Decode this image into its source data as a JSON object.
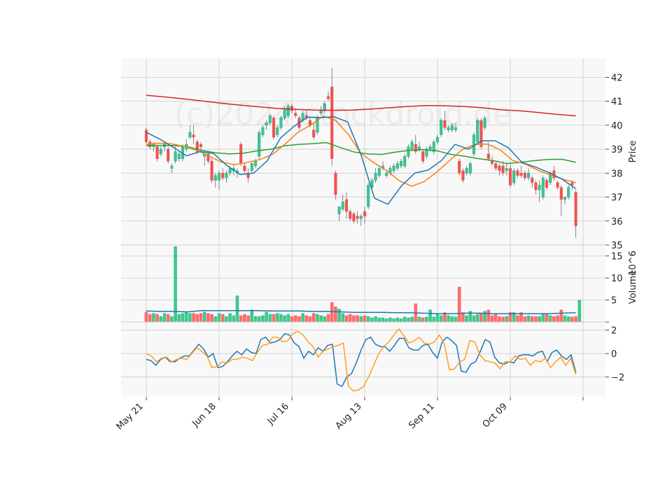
{
  "chart_data": {
    "type": "candlestick",
    "watermark": "(c)2024 stockdroid.de",
    "x_tick_labels": [
      "May 21",
      "Jun 18",
      "Jul 16",
      "Aug 13",
      "Sep 11",
      "Oct 09"
    ],
    "x_tick_index": [
      0,
      20,
      40,
      60,
      80,
      100
    ],
    "price_panel": {
      "ylabel": "Price",
      "ylim": [
        35,
        42.8
      ],
      "yticks": [
        35,
        36,
        37,
        38,
        39,
        40,
        41,
        42
      ],
      "candles": [
        [
          39.8,
          39.9,
          39.2,
          39.3
        ],
        [
          39.3,
          39.4,
          39.0,
          39.1
        ],
        [
          39.1,
          39.3,
          38.9,
          39.2
        ],
        [
          39.1,
          39.2,
          38.5,
          38.6
        ],
        [
          38.8,
          39.1,
          38.7,
          39.0
        ],
        [
          39.1,
          39.3,
          38.9,
          39.2
        ],
        [
          39.0,
          39.1,
          38.4,
          38.5
        ],
        [
          38.2,
          38.4,
          38.0,
          38.3
        ],
        [
          38.5,
          39.1,
          38.4,
          38.9
        ],
        [
          38.6,
          38.9,
          38.5,
          38.8
        ],
        [
          38.6,
          39.2,
          38.5,
          39.1
        ],
        [
          39.0,
          39.4,
          38.9,
          39.2
        ],
        [
          39.5,
          40.0,
          39.4,
          39.7
        ],
        [
          39.6,
          40.0,
          39.2,
          39.5
        ],
        [
          39.3,
          39.4,
          38.8,
          38.9
        ],
        [
          39.2,
          39.3,
          38.9,
          39.1
        ],
        [
          38.7,
          38.9,
          38.3,
          38.8
        ],
        [
          38.8,
          38.9,
          38.4,
          38.5
        ],
        [
          38.5,
          38.6,
          37.6,
          37.7
        ],
        [
          37.7,
          38.0,
          37.4,
          37.9
        ],
        [
          37.7,
          38.1,
          37.3,
          38.0
        ],
        [
          38.0,
          38.2,
          37.7,
          37.8
        ],
        [
          37.8,
          38.1,
          37.6,
          38.0
        ],
        [
          38.0,
          38.3,
          37.9,
          38.2
        ],
        [
          38.1,
          38.4,
          37.9,
          38.2
        ],
        [
          38.0,
          38.2,
          37.8,
          38.1
        ],
        [
          39.2,
          39.3,
          38.3,
          38.4
        ],
        [
          38.3,
          38.4,
          38.0,
          38.1
        ],
        [
          38.0,
          38.2,
          37.6,
          37.8
        ],
        [
          38.1,
          38.5,
          38.0,
          38.4
        ],
        [
          38.3,
          38.6,
          38.2,
          38.5
        ],
        [
          38.7,
          39.8,
          38.6,
          39.7
        ],
        [
          39.6,
          40.0,
          39.5,
          39.9
        ],
        [
          40.0,
          40.2,
          39.8,
          40.1
        ],
        [
          40.1,
          40.5,
          40.0,
          40.4
        ],
        [
          40.3,
          40.4,
          39.4,
          39.5
        ],
        [
          39.6,
          40.0,
          39.5,
          39.9
        ],
        [
          39.9,
          40.4,
          39.8,
          40.3
        ],
        [
          40.3,
          40.8,
          40.2,
          40.7
        ],
        [
          40.4,
          40.9,
          40.3,
          40.8
        ],
        [
          40.8,
          40.9,
          40.5,
          40.6
        ],
        [
          40.5,
          40.7,
          40.3,
          40.4
        ],
        [
          40.3,
          40.4,
          39.8,
          39.9
        ],
        [
          40.2,
          40.6,
          40.1,
          40.5
        ],
        [
          40.4,
          40.6,
          40.2,
          40.3
        ],
        [
          40.2,
          40.3,
          39.9,
          40.0
        ],
        [
          39.8,
          40.1,
          39.4,
          39.5
        ],
        [
          39.7,
          40.4,
          39.6,
          40.3
        ],
        [
          40.5,
          40.8,
          40.4,
          40.6
        ],
        [
          40.6,
          41.0,
          40.5,
          40.9
        ],
        [
          41.2,
          41.4,
          41.0,
          41.1
        ],
        [
          41.6,
          42.4,
          38.3,
          38.6
        ],
        [
          38.0,
          38.1,
          36.9,
          37.1
        ],
        [
          36.3,
          36.6,
          36.0,
          36.6
        ],
        [
          36.5,
          37.1,
          36.4,
          36.8
        ],
        [
          36.9,
          37.2,
          36.1,
          36.4
        ],
        [
          36.4,
          36.5,
          36.0,
          36.1
        ],
        [
          36.3,
          36.4,
          35.9,
          36.0
        ],
        [
          36.2,
          36.4,
          35.9,
          36.1
        ],
        [
          36.1,
          36.3,
          35.8,
          36.2
        ],
        [
          36.4,
          36.6,
          35.9,
          36.2
        ],
        [
          36.6,
          37.6,
          36.5,
          37.5
        ],
        [
          37.4,
          37.8,
          37.3,
          37.7
        ],
        [
          37.7,
          38.2,
          37.6,
          38.0
        ],
        [
          37.9,
          38.3,
          37.8,
          38.2
        ],
        [
          38.2,
          38.5,
          38.1,
          38.3
        ],
        [
          37.9,
          38.1,
          37.8,
          38.0
        ],
        [
          38.0,
          38.3,
          37.9,
          38.2
        ],
        [
          38.1,
          38.4,
          38.0,
          38.3
        ],
        [
          38.2,
          38.5,
          38.1,
          38.4
        ],
        [
          38.3,
          38.6,
          38.2,
          38.5
        ],
        [
          38.3,
          38.8,
          38.2,
          38.7
        ],
        [
          38.7,
          39.2,
          38.6,
          39.1
        ],
        [
          39.0,
          39.4,
          38.9,
          39.3
        ],
        [
          39.2,
          39.6,
          38.8,
          38.9
        ],
        [
          39.0,
          39.3,
          38.9,
          39.1
        ],
        [
          38.9,
          39.0,
          38.4,
          38.5
        ],
        [
          38.7,
          39.1,
          38.6,
          39.0
        ],
        [
          39.0,
          39.2,
          38.9,
          39.1
        ],
        [
          38.9,
          39.4,
          38.8,
          39.3
        ],
        [
          39.3,
          39.6,
          39.2,
          39.5
        ],
        [
          39.6,
          40.3,
          39.5,
          40.2
        ],
        [
          40.2,
          40.6,
          39.8,
          39.9
        ],
        [
          39.8,
          40.0,
          39.7,
          39.9
        ],
        [
          39.8,
          40.1,
          39.7,
          40.0
        ],
        [
          39.8,
          40.1,
          39.7,
          39.9
        ],
        [
          38.5,
          38.6,
          37.9,
          38.0
        ],
        [
          38.1,
          38.2,
          37.6,
          37.7
        ],
        [
          38.0,
          38.3,
          37.9,
          38.2
        ],
        [
          38.0,
          38.5,
          37.9,
          38.4
        ],
        [
          38.8,
          39.7,
          38.7,
          39.6
        ],
        [
          39.3,
          40.3,
          39.2,
          40.2
        ],
        [
          40.2,
          40.3,
          39.0,
          39.1
        ],
        [
          39.9,
          40.4,
          39.8,
          40.3
        ],
        [
          38.8,
          39.3,
          38.5,
          38.6
        ],
        [
          38.5,
          38.7,
          38.3,
          38.4
        ],
        [
          38.4,
          38.5,
          38.1,
          38.2
        ],
        [
          38.3,
          38.4,
          37.9,
          38.1
        ],
        [
          38.3,
          38.5,
          37.9,
          38.0
        ],
        [
          38.1,
          38.4,
          37.9,
          38.2
        ],
        [
          38.2,
          38.4,
          37.4,
          37.5
        ],
        [
          37.6,
          38.2,
          37.5,
          38.1
        ],
        [
          38.1,
          38.2,
          37.8,
          37.9
        ],
        [
          38.0,
          38.3,
          37.8,
          37.9
        ],
        [
          38.0,
          38.1,
          37.7,
          37.8
        ],
        [
          37.8,
          38.2,
          37.7,
          38.0
        ],
        [
          37.8,
          37.9,
          37.4,
          37.6
        ],
        [
          37.6,
          37.7,
          37.1,
          37.3
        ],
        [
          37.3,
          37.7,
          36.8,
          37.5
        ],
        [
          37.0,
          37.9,
          36.9,
          37.8
        ],
        [
          37.7,
          37.8,
          37.3,
          37.4
        ],
        [
          37.6,
          38.1,
          37.5,
          38.0
        ],
        [
          38.1,
          38.3,
          37.7,
          37.8
        ],
        [
          37.6,
          37.7,
          37.3,
          37.4
        ],
        [
          37.4,
          37.5,
          36.2,
          36.9
        ],
        [
          36.9,
          37.0,
          36.7,
          37.0
        ],
        [
          37.0,
          37.5,
          36.9,
          37.4
        ],
        [
          37.6,
          37.7,
          37.3,
          37.5
        ],
        [
          37.2,
          37.3,
          35.3,
          35.8
        ]
      ],
      "ma_series": [
        {
          "color": "#d62728",
          "values": [
            41.25,
            41.18,
            41.1,
            41.01,
            40.92,
            40.84,
            40.77,
            40.7,
            40.66,
            40.63,
            40.62,
            40.63,
            40.67,
            40.73,
            40.78,
            40.82,
            40.81,
            40.78,
            40.73,
            40.64,
            40.6,
            40.53,
            40.45,
            40.39
          ]
        },
        {
          "color": "#2ca02c",
          "values": [
            39.15,
            39.15,
            39.15,
            39.1,
            38.95,
            38.85,
            38.8,
            38.83,
            38.93,
            39.0,
            39.14,
            39.2,
            39.23,
            39.27,
            39.07,
            38.88,
            38.8,
            38.78,
            38.88,
            38.95,
            38.98,
            38.93,
            38.78,
            38.7,
            38.6,
            38.53,
            38.4,
            38.45,
            38.52,
            38.57,
            38.58,
            38.45
          ]
        },
        {
          "color": "#ff7f0e",
          "values": [
            39.2,
            39.25,
            39.22,
            39.12,
            38.95,
            38.7,
            38.45,
            38.35,
            38.44,
            38.57,
            38.78,
            39.22,
            39.7,
            40.0,
            40.38,
            40.2,
            39.6,
            38.82,
            38.44,
            38.12,
            37.69,
            37.45,
            37.65,
            38.05,
            38.52,
            38.98,
            39.2,
            39.21,
            38.98,
            38.53,
            38.38,
            38.12,
            37.92,
            37.74,
            37.6
          ]
        },
        {
          "color": "#1f77b4",
          "values": [
            39.7,
            39.42,
            39.08,
            38.72,
            38.9,
            38.82,
            38.32,
            37.94,
            38.0,
            38.51,
            39.47,
            39.95,
            40.33,
            40.32,
            40.35,
            40.14,
            38.76,
            36.95,
            36.7,
            37.46,
            38.0,
            38.13,
            38.53,
            39.2,
            39.0,
            39.35,
            39.35,
            39.05,
            38.44,
            38.25,
            38.02,
            37.74,
            37.35
          ]
        }
      ]
    },
    "volume_panel": {
      "ylabel": "Volume",
      "exponent": "10^6",
      "ylim": [
        0,
        17.5
      ],
      "yticks": [
        0,
        5,
        10,
        15
      ],
      "ytick_labels": [
        "",
        "5",
        "10",
        "15"
      ],
      "values": [
        2.3,
        1.8,
        2.0,
        1.8,
        1.3,
        2.0,
        1.8,
        1.3,
        17.2,
        1.8,
        2.0,
        2.3,
        2.0,
        2.0,
        1.8,
        2.0,
        2.3,
        2.0,
        1.8,
        1.3,
        2.0,
        1.8,
        1.3,
        2.0,
        1.5,
        6.0,
        1.5,
        1.8,
        1.5,
        2.8,
        1.3,
        1.3,
        1.5,
        2.3,
        1.8,
        1.8,
        2.0,
        1.8,
        1.5,
        1.8,
        1.3,
        1.5,
        1.3,
        2.0,
        1.5,
        1.3,
        2.0,
        1.8,
        1.5,
        1.3,
        1.8,
        4.5,
        3.5,
        3.0,
        2.0,
        1.5,
        1.8,
        1.5,
        1.5,
        1.3,
        1.5,
        1.3,
        1.0,
        1.3,
        1.0,
        1.0,
        0.8,
        1.0,
        0.8,
        1.0,
        0.8,
        1.2,
        1.0,
        1.2,
        4.2,
        1.2,
        1.0,
        1.2,
        2.8,
        1.2,
        1.8,
        1.5,
        2.2,
        1.5,
        1.3,
        1.2,
        8.0,
        2.2,
        1.5,
        2.5,
        1.5,
        1.8,
        2.0,
        2.5,
        2.8,
        1.5,
        2.0,
        1.3,
        1.2,
        1.3,
        2.2,
        2.2,
        1.5,
        2.2,
        1.3,
        1.5,
        1.3,
        1.3,
        1.3,
        2.0,
        1.8,
        1.5,
        1.3,
        1.5,
        2.8,
        1.5,
        1.3,
        1.2,
        1.3,
        5.0
      ],
      "avg_line": {
        "color": "#1f77b4",
        "values": [
          2.5,
          2.4,
          2.4,
          2.3,
          2.6,
          2.6,
          2.6,
          2.6,
          2.6,
          2.5,
          2.5,
          2.5,
          2.4,
          2.4,
          2.3,
          2.2,
          2.2,
          2.2,
          2.1,
          2.1,
          2.0,
          1.9,
          1.9,
          2.0,
          2.0,
          1.9,
          1.9,
          1.9,
          1.9,
          1.9,
          2.0,
          2.1
        ]
      }
    },
    "oscillator_panel": {
      "ylim": [
        -3.7,
        2.7
      ],
      "yticks": [
        -2,
        0,
        2
      ],
      "ytick_labels": [
        "−2",
        "0",
        "2"
      ],
      "lines": [
        {
          "color": "#1f77b4",
          "values": [
            -0.5,
            -0.6,
            -1.0,
            -0.5,
            -0.3,
            -0.7,
            -0.7,
            -0.4,
            -0.2,
            -0.2,
            0.3,
            0.8,
            0.4,
            -0.3,
            0.0,
            -1.2,
            -1.1,
            -0.7,
            -0.2,
            0.2,
            -0.1,
            0.4,
            0.1,
            0.0,
            1.2,
            1.4,
            0.9,
            1.0,
            1.2,
            1.7,
            1.6,
            0.9,
            0.6,
            -0.4,
            0.2,
            -0.1,
            0.5,
            0.2,
            0.7,
            0.8,
            -2.6,
            -2.8,
            -2.0,
            -1.7,
            -0.8,
            0.3,
            1.2,
            1.4,
            0.8,
            0.6,
            0.6,
            0.2,
            0.7,
            1.3,
            1.3,
            0.5,
            0.3,
            0.3,
            0.7,
            0.8,
            0.1,
            -0.4,
            1.0,
            1.4,
            1.1,
            0.7,
            -1.5,
            -1.6,
            -0.9,
            -0.7,
            0.2,
            1.2,
            1.0,
            -0.3,
            -0.8,
            -0.9,
            -0.7,
            -0.8,
            -0.2,
            -0.1,
            -0.1,
            -0.2,
            0.1,
            0.2,
            -0.7,
            0.1,
            0.3,
            -0.2,
            -0.5,
            -0.1,
            -1.6
          ]
        },
        {
          "color": "#ff9f1c",
          "values": [
            0.0,
            -0.2,
            -0.7,
            -0.4,
            -0.3,
            -0.7,
            -0.5,
            -0.4,
            -0.5,
            0.0,
            0.5,
            0.2,
            -0.2,
            -1.2,
            -1.1,
            -0.7,
            -0.8,
            -0.5,
            -0.5,
            -0.3,
            -0.4,
            -0.6,
            0.1,
            0.7,
            0.8,
            1.4,
            1.4,
            1.0,
            1.1,
            1.7,
            1.9,
            1.6,
            1.0,
            0.6,
            -0.3,
            0.2,
            0.4,
            0.6,
            0.7,
            0.9,
            -2.8,
            -3.2,
            -3.1,
            -2.8,
            -2.0,
            -1.0,
            0.0,
            0.6,
            1.0,
            1.6,
            2.1,
            1.5,
            0.9,
            1.1,
            1.4,
            0.9,
            0.8,
            1.0,
            1.6,
            0.8,
            -1.4,
            -1.3,
            -0.7,
            -0.5,
            1.1,
            1.0,
            -0.1,
            -0.6,
            -0.7,
            -0.8,
            -1.3,
            -0.7,
            -0.7,
            -0.2,
            -0.5,
            -0.4,
            -1.0,
            -0.6,
            -0.7,
            -0.4,
            -1.2,
            -0.7,
            -0.3,
            -1.0,
            -0.4,
            -1.8
          ]
        }
      ]
    },
    "colors": {
      "up": "#26a69a",
      "up_fill": "#3fc78b",
      "down": "#ef5350",
      "down_fill": "#ff6b6b",
      "panel_bg": "#f8f8f8",
      "grid": "#cccccc"
    }
  }
}
